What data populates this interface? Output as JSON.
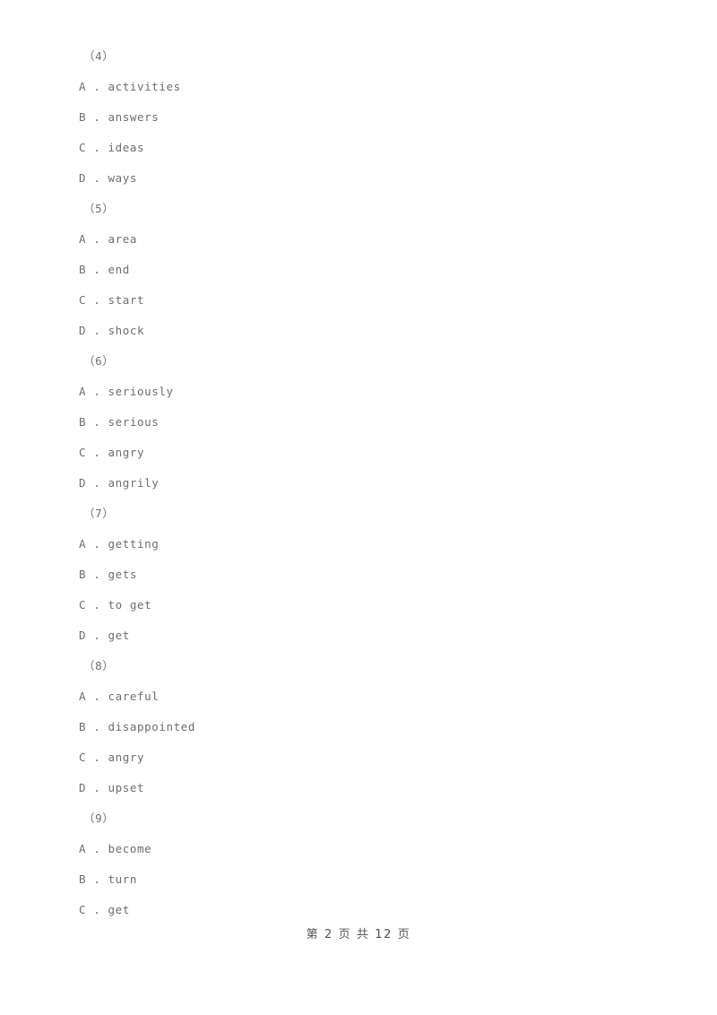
{
  "document": {
    "page_background": "#ffffff",
    "text_color": "#6e6e6e",
    "blocks": [
      {
        "number": "（4）",
        "options": [
          {
            "letter": "A",
            "separator": " . ",
            "text": "activities"
          },
          {
            "letter": "B",
            "separator": " . ",
            "text": "answers"
          },
          {
            "letter": "C",
            "separator": " . ",
            "text": "ideas"
          },
          {
            "letter": "D",
            "separator": " . ",
            "text": "ways"
          }
        ]
      },
      {
        "number": "（5）",
        "options": [
          {
            "letter": "A",
            "separator": " . ",
            "text": "area"
          },
          {
            "letter": "B",
            "separator": " . ",
            "text": "end"
          },
          {
            "letter": "C",
            "separator": " . ",
            "text": "start"
          },
          {
            "letter": "D",
            "separator": " . ",
            "text": "shock"
          }
        ]
      },
      {
        "number": "（6）",
        "options": [
          {
            "letter": "A",
            "separator": " . ",
            "text": "seriously"
          },
          {
            "letter": "B",
            "separator": " . ",
            "text": "serious"
          },
          {
            "letter": "C",
            "separator": " . ",
            "text": "angry"
          },
          {
            "letter": "D",
            "separator": " . ",
            "text": "angrily"
          }
        ]
      },
      {
        "number": "（7）",
        "options": [
          {
            "letter": "A",
            "separator": " . ",
            "text": "getting"
          },
          {
            "letter": "B",
            "separator": " . ",
            "text": "gets"
          },
          {
            "letter": "C",
            "separator": " . ",
            "text": "to get"
          },
          {
            "letter": "D",
            "separator": " . ",
            "text": "get"
          }
        ]
      },
      {
        "number": "（8）",
        "options": [
          {
            "letter": "A",
            "separator": " . ",
            "text": "careful"
          },
          {
            "letter": "B",
            "separator": " . ",
            "text": "disappointed"
          },
          {
            "letter": "C",
            "separator": " . ",
            "text": "angry"
          },
          {
            "letter": "D",
            "separator": " . ",
            "text": "upset"
          }
        ]
      },
      {
        "number": "（9）",
        "options": [
          {
            "letter": "A",
            "separator": " . ",
            "text": "become"
          },
          {
            "letter": "B",
            "separator": " . ",
            "text": "turn"
          },
          {
            "letter": "C",
            "separator": " . ",
            "text": "get"
          }
        ]
      }
    ]
  },
  "footer": {
    "page_label": "第 2 页 共 12 页",
    "current_page": "2",
    "total_pages": "12"
  }
}
